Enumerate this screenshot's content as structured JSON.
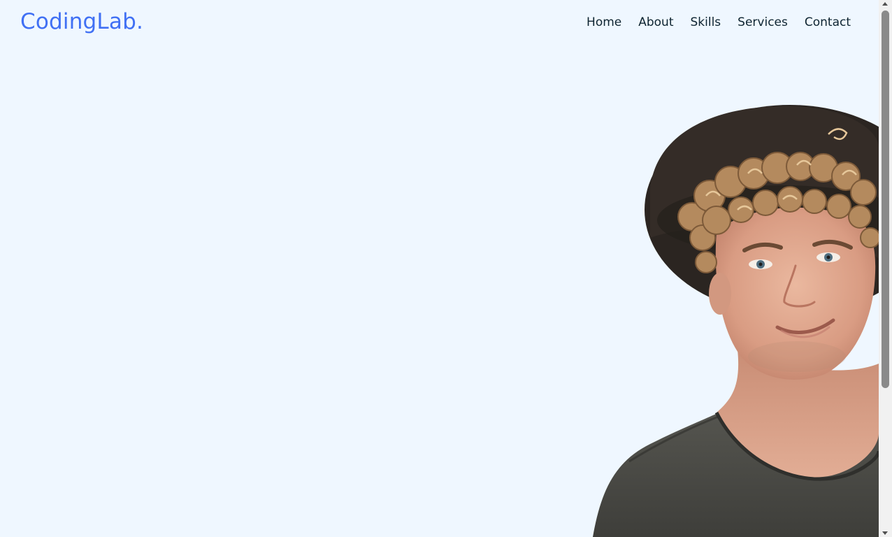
{
  "brand": {
    "logo_text": "CodingLab."
  },
  "nav": {
    "items": [
      {
        "label": "Home"
      },
      {
        "label": "About"
      },
      {
        "label": "Skills"
      },
      {
        "label": "Services"
      },
      {
        "label": "Contact"
      }
    ]
  },
  "hero": {
    "image": "portrait-photo"
  },
  "colors": {
    "background": "#eff7ff",
    "accent": "#4070f4",
    "nav_text": "#0e2431"
  }
}
